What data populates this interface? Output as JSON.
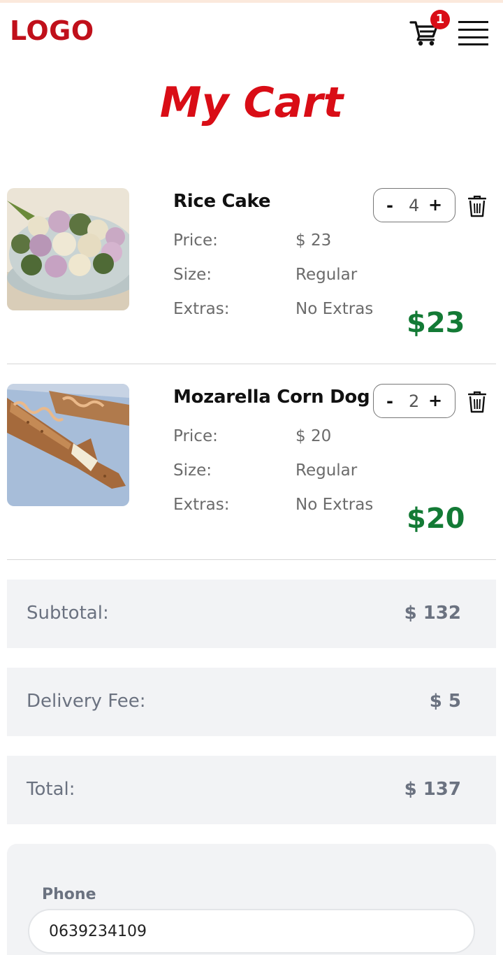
{
  "header": {
    "logo": "LOGO",
    "cart_count": "1"
  },
  "page": {
    "title": "My Cart"
  },
  "cart": {
    "items": [
      {
        "name": "Rice Cake",
        "price_label": "Price:",
        "price": "$ 23",
        "size_label": "Size:",
        "size": "Regular",
        "extras_label": "Extras:",
        "extras": "No Extras",
        "qty_minus": "-",
        "quantity": "4",
        "qty_plus": "+",
        "line_total": "$23"
      },
      {
        "name": "Mozarella Corn Dog",
        "price_label": "Price:",
        "price": "$ 20",
        "size_label": "Size:",
        "size": "Regular",
        "extras_label": "Extras:",
        "extras": "No Extras",
        "qty_minus": "-",
        "quantity": "2",
        "qty_plus": "+",
        "line_total": "$20"
      }
    ]
  },
  "summary": {
    "subtotal_label": "Subtotal:",
    "subtotal": "$ 132",
    "delivery_label": "Delivery Fee:",
    "delivery": "$ 5",
    "total_label": "Total:",
    "total": "$ 137"
  },
  "form": {
    "phone_label": "Phone",
    "phone_value": "0639234109"
  },
  "colors": {
    "brand_red": "#d90d16",
    "price_green": "#137a35",
    "summary_bg": "#f2f3f5"
  },
  "icons": [
    "cart-icon",
    "menu-icon",
    "trash-icon"
  ]
}
